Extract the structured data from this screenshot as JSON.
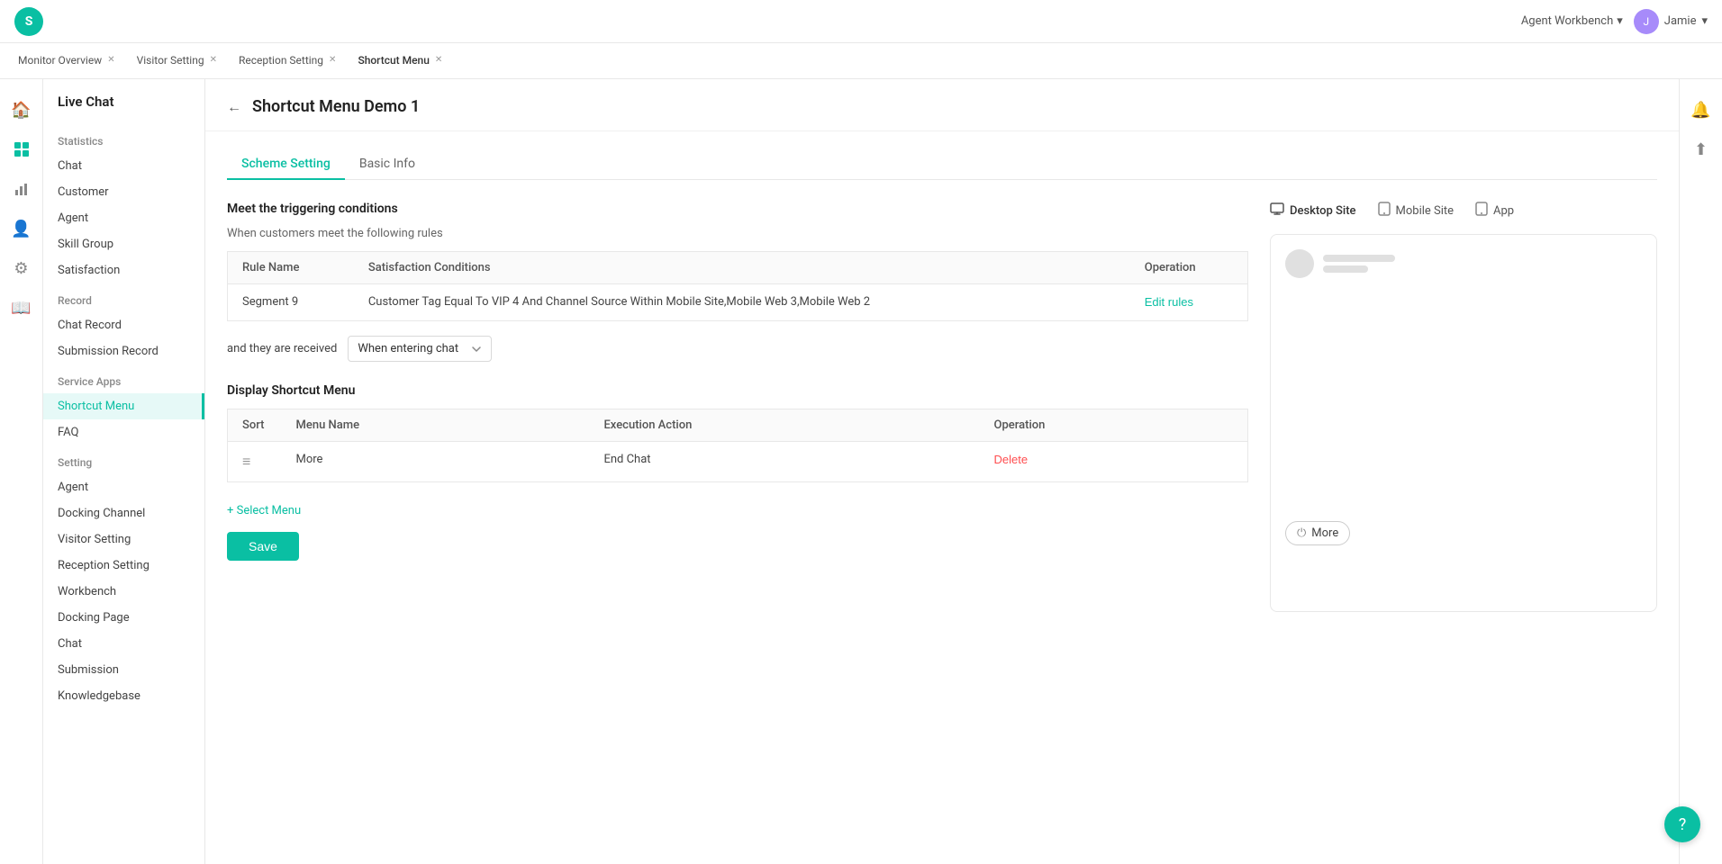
{
  "topbar": {
    "logo": "S",
    "agent_workbench": "Agent Workbench",
    "user_name": "Jamie",
    "chevron": "▾"
  },
  "tabs": [
    {
      "label": "Monitor Overview",
      "closable": true
    },
    {
      "label": "Visitor Setting",
      "closable": true
    },
    {
      "label": "Reception Setting",
      "closable": true
    },
    {
      "label": "Shortcut Menu",
      "closable": true
    }
  ],
  "sidebar_icons": [
    {
      "name": "home-icon",
      "symbol": "⌂"
    },
    {
      "name": "grid-icon",
      "symbol": "⊞"
    },
    {
      "name": "chart-icon",
      "symbol": "↑"
    },
    {
      "name": "user-icon",
      "symbol": "👤"
    },
    {
      "name": "settings-icon",
      "symbol": "⚙"
    },
    {
      "name": "book-icon",
      "symbol": "📖"
    }
  ],
  "left_nav": {
    "title": "Live Chat",
    "statistics_section": "Statistics",
    "statistics_items": [
      {
        "label": "Chat",
        "active": false
      },
      {
        "label": "Customer",
        "active": false
      },
      {
        "label": "Agent",
        "active": false
      },
      {
        "label": "Skill Group",
        "active": false
      },
      {
        "label": "Satisfaction",
        "active": false
      }
    ],
    "record_section": "Record",
    "record_items": [
      {
        "label": "Chat Record",
        "active": false
      },
      {
        "label": "Submission Record",
        "active": false
      }
    ],
    "service_apps_section": "Service Apps",
    "service_apps_items": [
      {
        "label": "Shortcut Menu",
        "active": true
      },
      {
        "label": "FAQ",
        "active": false
      }
    ],
    "setting_section": "Setting",
    "setting_items": [
      {
        "label": "Agent",
        "active": false
      },
      {
        "label": "Docking Channel",
        "active": false
      },
      {
        "label": "Visitor Setting",
        "active": false
      },
      {
        "label": "Reception Setting",
        "active": false
      },
      {
        "label": "Workbench",
        "active": false
      },
      {
        "label": "Docking Page",
        "active": false
      },
      {
        "label": "Chat",
        "active": false
      },
      {
        "label": "Submission",
        "active": false
      },
      {
        "label": "Knowledgebase",
        "active": false
      }
    ]
  },
  "page": {
    "back_label": "←",
    "title": "Shortcut Menu Demo 1",
    "sub_tabs": [
      {
        "label": "Scheme Setting",
        "active": true
      },
      {
        "label": "Basic Info",
        "active": false
      }
    ]
  },
  "trigger_section": {
    "title": "Meet the triggering conditions",
    "subtitle": "When customers meet the following rules",
    "table": {
      "columns": [
        "Rule Name",
        "Satisfaction Conditions",
        "Operation"
      ],
      "rows": [
        {
          "rule_name": "Segment 9",
          "conditions": "Customer Tag Equal To VIP 4 And Channel Source Within Mobile Site,Mobile Web 3,Mobile Web 2",
          "operation": "Edit rules"
        }
      ]
    },
    "received_label": "and they are received",
    "received_value": "When entering chat",
    "dropdown_arrow": "▾"
  },
  "shortcut_section": {
    "title": "Display Shortcut Menu",
    "table": {
      "columns": [
        "Sort",
        "Menu Name",
        "Execution Action",
        "Operation"
      ],
      "rows": [
        {
          "sort_icon": "≡",
          "menu_name": "More",
          "execution_action": "End Chat",
          "operation": "Delete"
        }
      ]
    },
    "add_label": "+ Select Menu",
    "save_label": "Save"
  },
  "preview": {
    "tabs": [
      {
        "label": "Desktop Site",
        "icon": "🖥",
        "active": true
      },
      {
        "label": "Mobile Site",
        "icon": "📱",
        "active": false
      },
      {
        "label": "App",
        "icon": "📱",
        "active": false
      }
    ],
    "more_button": "More",
    "power_icon": "⏻"
  },
  "help": {
    "icon": "?"
  }
}
